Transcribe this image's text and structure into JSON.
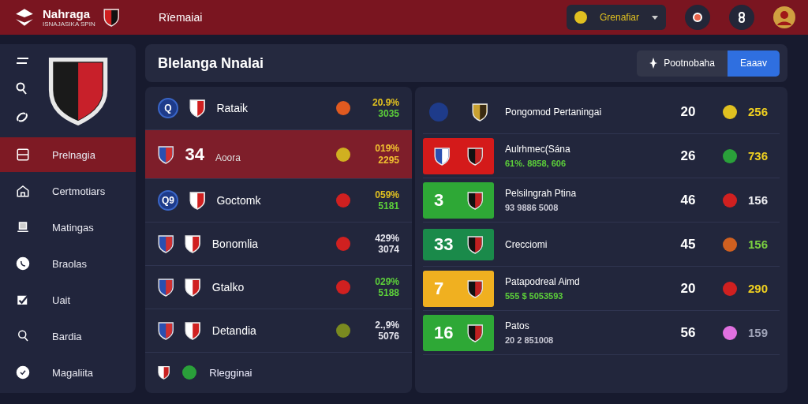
{
  "header": {
    "brand": "Nahraga",
    "brand_sub": "ISNAJASIKA SPIN",
    "title": "Rïemaiai",
    "league": {
      "label": "Grenafiar",
      "color": "#e0c020"
    }
  },
  "sidebar": {
    "items": [
      {
        "label": "Prelnagia",
        "selected": true
      },
      {
        "label": "Certmotiars",
        "selected": false
      },
      {
        "label": "Matingas",
        "selected": false
      },
      {
        "label": "Braolas",
        "selected": false
      },
      {
        "label": "Uait",
        "selected": false
      },
      {
        "label": "Bardia",
        "selected": false
      },
      {
        "label": "Magaliita",
        "selected": false
      }
    ]
  },
  "panel": {
    "title": "Blelanga Nnalai",
    "buttons": [
      {
        "label": "Pootnobaha",
        "kind": "secondary"
      },
      {
        "label": "Eaaav",
        "kind": "primary"
      }
    ]
  },
  "matches": [
    {
      "badge": "Q",
      "name": "Rataik",
      "selected": false,
      "status": {
        "color": "#e05a20"
      },
      "stats": [
        {
          "text": "20.9%",
          "color": "#e0c020"
        },
        {
          "text": "3035",
          "color": "#5ccf3a"
        }
      ]
    },
    {
      "number": "34",
      "name": "Aoora",
      "selected": true,
      "status": {
        "color": "#d0b020"
      },
      "stats": [
        {
          "text": "019%",
          "color": "#f0c030"
        },
        {
          "text": "2295",
          "color": "#f0c030"
        }
      ]
    },
    {
      "badge": "Q9",
      "name": "Goctomk",
      "selected": false,
      "status": {
        "color": "#d02020"
      },
      "stats": [
        {
          "text": "059%",
          "color": "#e0c020"
        },
        {
          "text": "5181",
          "color": "#5ccf3a"
        }
      ]
    },
    {
      "name": "Bonomlia",
      "selected": false,
      "status": {
        "color": "#d02020"
      },
      "stats": [
        {
          "text": "429%",
          "color": "#e6e6ee"
        },
        {
          "text": "3074",
          "color": "#e6e6ee"
        }
      ]
    },
    {
      "name": "Gtalko",
      "selected": false,
      "status": {
        "color": "#d02020"
      },
      "stats": [
        {
          "text": "029%",
          "color": "#5ccf3a"
        },
        {
          "text": "5188",
          "color": "#5ccf3a"
        }
      ]
    },
    {
      "name": "Detandia",
      "selected": false,
      "status": {
        "color": "#7a8a20"
      },
      "stats": [
        {
          "text": "2.,9%",
          "color": "#e6e6ee"
        },
        {
          "text": "5076",
          "color": "#e6e6ee"
        }
      ]
    }
  ],
  "matches_footer": "Rlegginai",
  "standings": [
    {
      "title": "Pongomod Pertaningai",
      "points": "20",
      "status": {
        "color": "#e0c020"
      },
      "value": {
        "text": "256",
        "color": "#f0d020"
      }
    },
    {
      "tile": {
        "color": "#d41a1a"
      },
      "title": "Aulrhmec(Sána",
      "subtitle": {
        "text": "61%. 8858, 606",
        "color": "#5ccf3a"
      },
      "points": "26",
      "status": {
        "color": "#2aa03a"
      },
      "value": {
        "text": "736",
        "color": "#f0d020"
      }
    },
    {
      "tile": {
        "color": "#2ea836",
        "number": "3"
      },
      "title": "Pelsilngrah Ptina",
      "subtitle": {
        "text": "93 9886 5008",
        "color": "#c8c8d4"
      },
      "points": "46",
      "status": {
        "color": "#d02020"
      },
      "value": {
        "text": "156",
        "color": "#f0f0f4"
      }
    },
    {
      "tile": {
        "color": "#1a8a4a",
        "number": "33"
      },
      "title": "Crecciomi",
      "points": "45",
      "status": {
        "color": "#d06020"
      },
      "value": {
        "text": "156",
        "color": "#7ad040"
      }
    },
    {
      "tile": {
        "color": "#f0b020",
        "number": "7"
      },
      "title": "Patapodreal Aimd",
      "subtitle": {
        "text": "555 $ 5053593",
        "color": "#5ccf3a"
      },
      "points": "20",
      "status": {
        "color": "#d02020"
      },
      "value": {
        "text": "290",
        "color": "#f0d020"
      }
    },
    {
      "tile": {
        "color": "#2ea836",
        "number": "16"
      },
      "title": "Patos",
      "subtitle": {
        "text": "20 2 851008",
        "color": "#c8c8d4"
      },
      "points": "56",
      "status": {
        "color": "#e070e0"
      },
      "value": {
        "text": "159",
        "color": "#a0a4b8"
      }
    }
  ]
}
